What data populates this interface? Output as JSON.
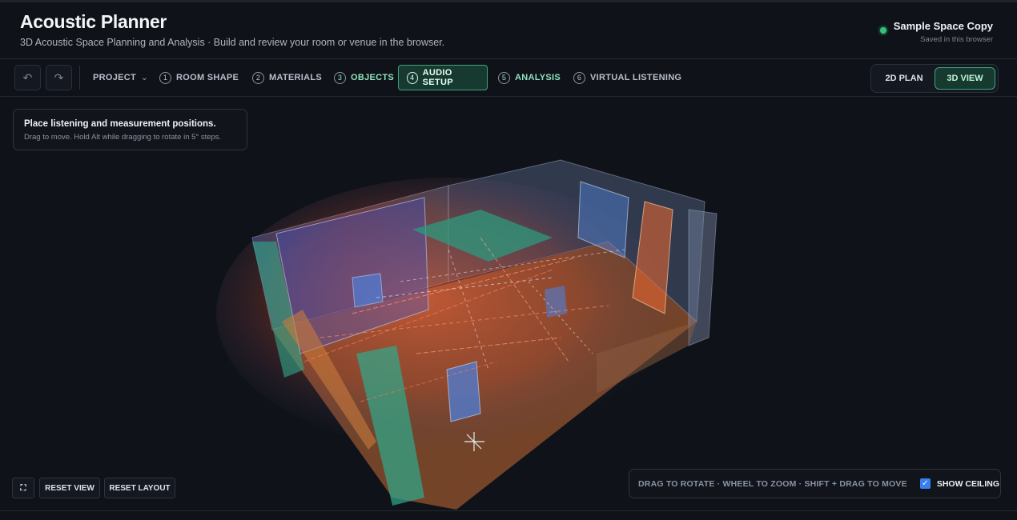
{
  "app": {
    "title": "Acoustic Planner",
    "subtitle": "3D Acoustic Space Planning and Analysis · Build and review your room or venue in the browser."
  },
  "save_status": {
    "name": "Sample Space Copy",
    "detail": "Saved in this browser",
    "indicator_color": "#35c07c"
  },
  "toolbar": {
    "undo_icon": "undo-icon",
    "redo_icon": "redo-icon",
    "project_label": "PROJECT",
    "steps": [
      {
        "num": "1",
        "label": "ROOM SHAPE",
        "state": "default"
      },
      {
        "num": "2",
        "label": "MATERIALS",
        "state": "default"
      },
      {
        "num": "3",
        "label": "OBJECTS",
        "state": "done"
      },
      {
        "num": "4",
        "label": "AUDIO SETUP",
        "state": "active"
      },
      {
        "num": "5",
        "label": "ANALYSIS",
        "state": "done"
      },
      {
        "num": "6",
        "label": "VIRTUAL LISTENING",
        "state": "default"
      }
    ],
    "view_2d": "2D PLAN",
    "view_3d": "3D VIEW",
    "active_view": "3D VIEW"
  },
  "viewport": {
    "hint_title": "Place listening and measurement positions.",
    "hint_detail": "Drag to move. Hold Alt while dragging to rotate in 5° steps.",
    "fullscreen_icon": "fullscreen-icon",
    "reset_view": "RESET VIEW",
    "reset_layout": "RESET LAYOUT",
    "controls_hint": "DRAG TO ROTATE · WHEEL TO ZOOM · SHIFT + DRAG TO MOVE",
    "show_ceiling_label": "SHOW CEILING",
    "show_ceiling": true
  },
  "colors": {
    "accent": "#3ea37a",
    "accent_bg": "#173a30",
    "checkbox": "#3a7ff0"
  }
}
